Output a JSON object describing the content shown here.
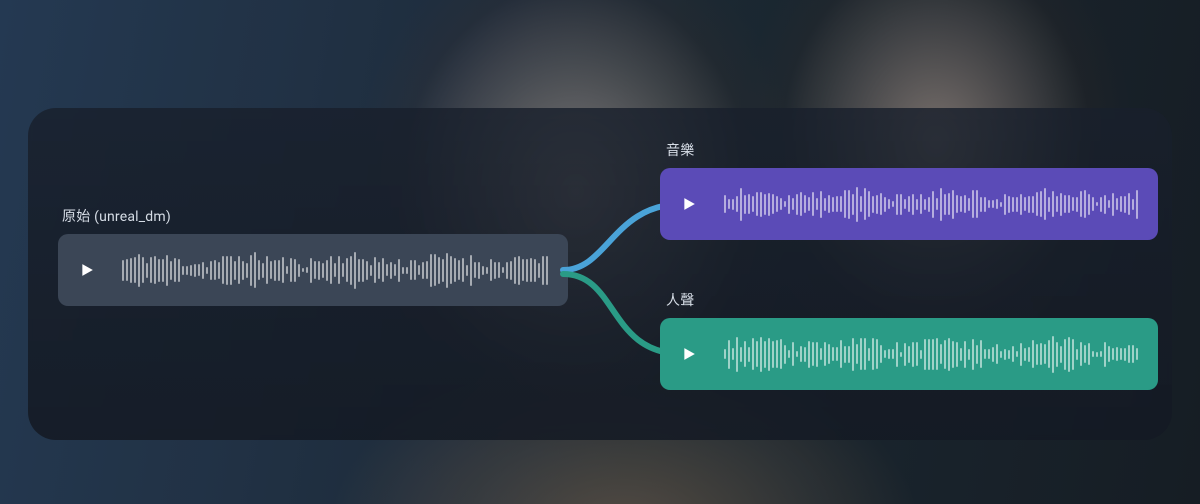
{
  "labels": {
    "original": "原始 (unreal_dm)",
    "music": "音樂",
    "voice": "人聲"
  },
  "tracks": {
    "original": {
      "color": "#3b4656"
    },
    "music": {
      "color": "#5b4bb7"
    },
    "voice": {
      "color": "#2a9b86"
    }
  },
  "connector_colors": {
    "music": "#4aa3d8",
    "voice": "#2a9b86"
  }
}
